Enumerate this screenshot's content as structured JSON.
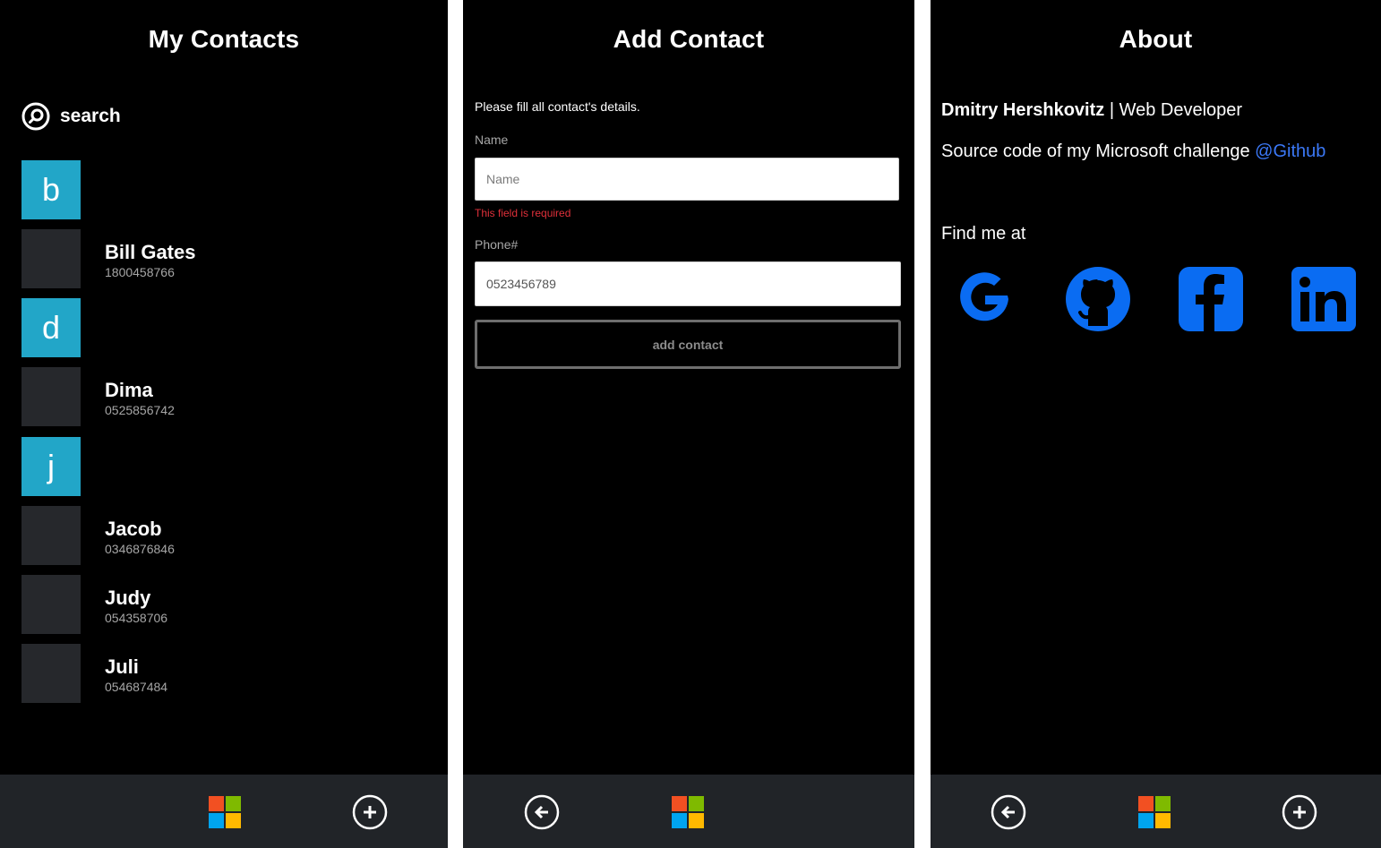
{
  "contacts_screen": {
    "title": "My Contacts",
    "search_label": "search",
    "groups": [
      {
        "letter": "b",
        "contacts": [
          {
            "name": "Bill Gates",
            "phone": "1800458766"
          }
        ]
      },
      {
        "letter": "d",
        "contacts": [
          {
            "name": "Dima",
            "phone": "0525856742"
          }
        ]
      },
      {
        "letter": "j",
        "contacts": [
          {
            "name": "Jacob",
            "phone": "0346876846"
          },
          {
            "name": "Judy",
            "phone": "054358706"
          },
          {
            "name": "Juli",
            "phone": "054687484"
          }
        ]
      }
    ]
  },
  "add_screen": {
    "title": "Add Contact",
    "intro": "Please fill all contact's details.",
    "name_label": "Name",
    "name_placeholder": "Name",
    "name_value": "",
    "name_error": "This field is required",
    "phone_label": "Phone#",
    "phone_value": "0523456789",
    "submit_label": "add contact"
  },
  "about_screen": {
    "title": "About",
    "author_name": "Dmitry Hershkovitz",
    "separator": " | ",
    "author_role": "Web Developer",
    "source_text": "Source code of my Microsoft challenge ",
    "source_link": "@Github",
    "find_me": "Find me at",
    "social_icons": [
      "google-icon",
      "github-icon",
      "facebook-icon",
      "linkedin-icon"
    ]
  },
  "colors": {
    "background": "#000000",
    "bottom_bar": "#212428",
    "group_tile": "#22a6c8",
    "avatar_tile": "#26282c",
    "link": "#3b78f6",
    "social_icon": "#0a6cf2",
    "error": "#e0303a",
    "ms_red": "#f25022",
    "ms_green": "#7fba00",
    "ms_blue": "#00a4ef",
    "ms_yellow": "#ffb900"
  }
}
